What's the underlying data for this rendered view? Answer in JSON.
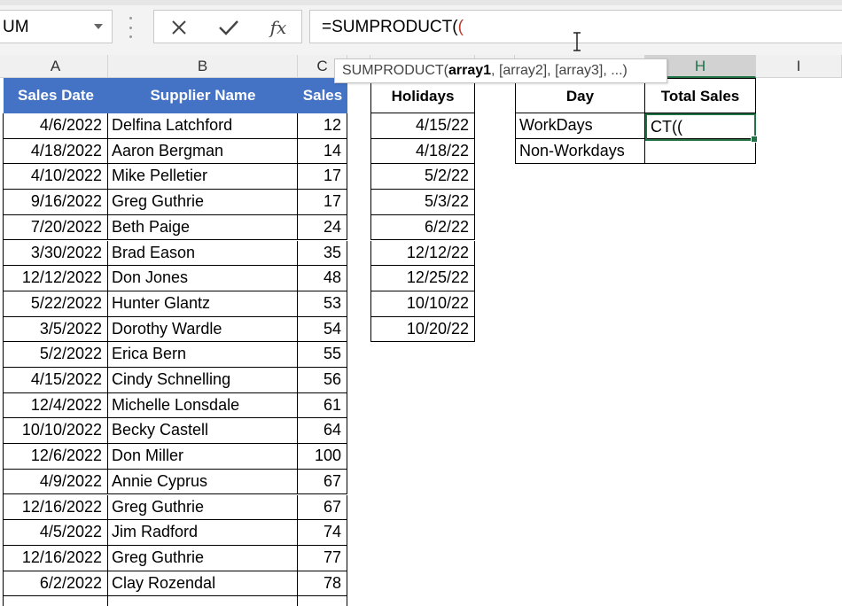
{
  "name_box": {
    "value": "UM"
  },
  "formula_bar": {
    "text": "=SUMPRODUCT(",
    "text_paren": "("
  },
  "tooltip": {
    "func": "SUMPRODUCT(",
    "arg1": "array1",
    "rest": ", [array2], [array3], ...)"
  },
  "columns": [
    {
      "label": "A",
      "selected": false
    },
    {
      "label": "B",
      "selected": false
    },
    {
      "label": "C",
      "selected": false
    },
    {
      "label": "",
      "selected": false
    },
    {
      "label": "",
      "selected": false
    },
    {
      "label": "",
      "selected": false
    },
    {
      "label": "",
      "selected": false
    },
    {
      "label": "H",
      "selected": true
    },
    {
      "label": "I",
      "selected": false
    }
  ],
  "sales_table": {
    "headers": [
      "Sales Date",
      "Supplier Name",
      "Sales"
    ],
    "rows": [
      [
        "4/6/2022",
        "Delfina Latchford",
        "12"
      ],
      [
        "4/18/2022",
        "Aaron Bergman",
        "14"
      ],
      [
        "4/10/2022",
        "Mike Pelletier",
        "17"
      ],
      [
        "9/16/2022",
        "Greg Guthrie",
        "17"
      ],
      [
        "7/20/2022",
        "Beth Paige",
        "24"
      ],
      [
        "3/30/2022",
        "Brad Eason",
        "35"
      ],
      [
        "12/12/2022",
        "Don Jones",
        "48"
      ],
      [
        "5/22/2022",
        "Hunter Glantz",
        "53"
      ],
      [
        "3/5/2022",
        "Dorothy Wardle",
        "54"
      ],
      [
        "5/2/2022",
        "Erica Bern",
        "55"
      ],
      [
        "4/15/2022",
        "Cindy Schnelling",
        "56"
      ],
      [
        "12/4/2022",
        "Michelle Lonsdale",
        "61"
      ],
      [
        "10/10/2022",
        "Becky Castell",
        "64"
      ],
      [
        "12/6/2022",
        "Don Miller",
        "100"
      ],
      [
        "4/9/2022",
        "Annie Cyprus",
        "67"
      ],
      [
        "12/16/2022",
        "Greg Guthrie",
        "67"
      ],
      [
        "4/5/2022",
        "Jim Radford",
        "74"
      ],
      [
        "12/16/2022",
        "Greg Guthrie",
        "77"
      ],
      [
        "6/2/2022",
        "Clay Rozendal",
        "78"
      ]
    ]
  },
  "holidays": {
    "header": "Holidays",
    "dates": [
      "4/15/22",
      "4/18/22",
      "5/2/22",
      "5/3/22",
      "6/2/22",
      "12/12/22",
      "12/25/22",
      "10/10/22",
      "10/20/22"
    ]
  },
  "summary": {
    "headers": [
      "Day",
      "Total Sales"
    ],
    "rows": [
      {
        "day": "WorkDays",
        "total": ""
      },
      {
        "day": "Non-Workdays",
        "total": ""
      }
    ]
  },
  "active_cell": {
    "text": "CT(("
  }
}
